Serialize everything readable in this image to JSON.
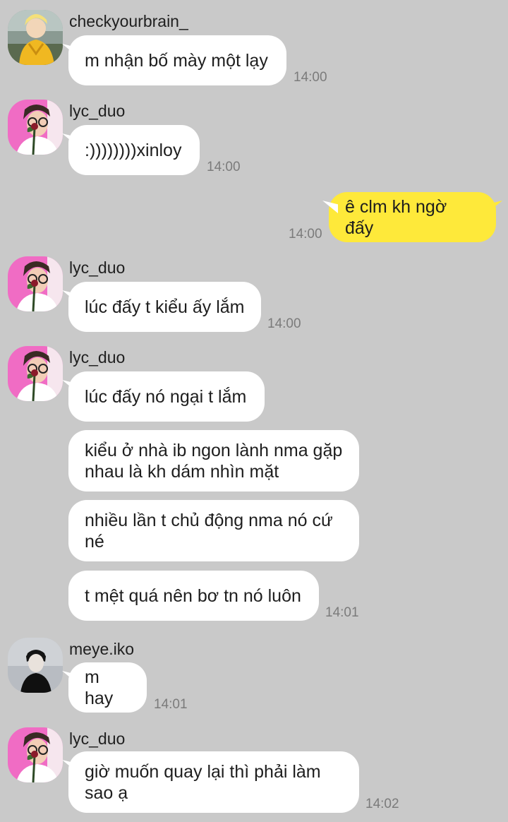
{
  "colors": {
    "background": "#c9c9c9",
    "incoming_bubble": "#ffffff",
    "outgoing_bubble": "#fee93a",
    "timestamp": "#7b7b7b"
  },
  "messages": [
    {
      "sender": "checkyourbrain_",
      "avatar": "person-in-yellow-jacket-avatar",
      "text": "m nhận bố mày một lạy",
      "time": "14:00"
    },
    {
      "sender": "lyc_duo",
      "avatar": "person-with-glasses-pink-background-avatar",
      "text": ":))))))))xinloy",
      "time": "14:00"
    },
    {
      "sender": "me",
      "text": "ê clm kh ngờ đấy",
      "time": "14:00"
    },
    {
      "sender": "lyc_duo",
      "avatar": "person-with-glasses-pink-background-avatar",
      "text": "lúc đấy t kiểu ấy lắm",
      "time": "14:00"
    },
    {
      "sender": "lyc_duo",
      "avatar": "person-with-glasses-pink-background-avatar",
      "text": "lúc đấy nó ngại t lắm"
    },
    {
      "text": "kiểu ở nhà ib ngon lành nma gặp\nnhau là kh dám nhìn mặt"
    },
    {
      "text": "nhiều lần t chủ động nma nó cứ\nné"
    },
    {
      "text": "t mệt quá nên bơ tn nó luôn",
      "time": "14:01"
    },
    {
      "sender": "meye.iko",
      "avatar": "person-in-black-grey-background-avatar",
      "text": "m hay",
      "time": "14:01"
    },
    {
      "sender": "lyc_duo",
      "avatar": "person-with-glasses-pink-background-avatar",
      "text": "giờ muốn quay lại thì phải làm\nsao ạ",
      "time": "14:02"
    }
  ]
}
